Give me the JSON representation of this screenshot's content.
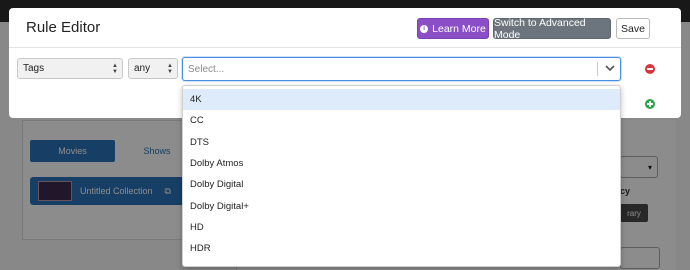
{
  "background": {
    "tabs": [
      {
        "label": "Movies"
      },
      {
        "label": "Shows"
      }
    ],
    "collection": {
      "label": "Untitled Collection"
    },
    "side_text": "cy",
    "side_button": "rary"
  },
  "modal": {
    "title": "Rule Editor",
    "buttons": {
      "learn_more": "Learn More",
      "advanced_mode": "Switch to Advanced Mode",
      "save": "Save"
    },
    "rule": {
      "field_value": "Tags",
      "operator_value": "any",
      "search_placeholder": "Select...",
      "search_value": ""
    }
  },
  "menu": {
    "options": [
      {
        "label": "4K",
        "highlighted": true
      },
      {
        "label": "CC"
      },
      {
        "label": "DTS"
      },
      {
        "label": "Dolby Atmos"
      },
      {
        "label": "Dolby Digital"
      },
      {
        "label": "Dolby Digital+"
      },
      {
        "label": "HD"
      },
      {
        "label": "HDR"
      }
    ]
  },
  "colors": {
    "learn_more_bg": "#8a4fc7",
    "advanced_bg": "#6c757d",
    "focus_border": "#4a90e2",
    "highlight_bg": "#deebfb",
    "remove_icon": "#d9363e",
    "add_icon": "#28a745",
    "primary_blue": "#2a74b8"
  }
}
